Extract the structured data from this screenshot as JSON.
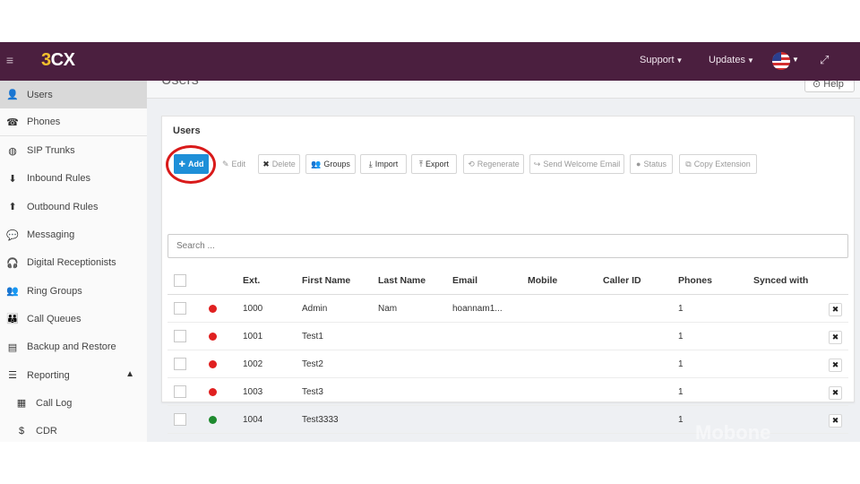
{
  "topbar": {
    "logo_3": "3",
    "logo_cx": "CX",
    "support_label": "Support",
    "updates_label": "Updates"
  },
  "sidebar": {
    "items": [
      {
        "label": "Users",
        "icon": "user-icon",
        "glyph": "👤"
      },
      {
        "label": "Phones",
        "icon": "phone-icon",
        "glyph": "☎"
      },
      {
        "label": "SIP Trunks",
        "icon": "globe-icon",
        "glyph": "◍"
      },
      {
        "label": "Inbound Rules",
        "icon": "arrow-down-icon",
        "glyph": "⬇"
      },
      {
        "label": "Outbound Rules",
        "icon": "arrow-up-icon",
        "glyph": "⬆"
      },
      {
        "label": "Messaging",
        "icon": "chat-icon",
        "glyph": "💬"
      },
      {
        "label": "Digital Receptionists",
        "icon": "headset-icon",
        "glyph": "🎧"
      },
      {
        "label": "Ring Groups",
        "icon": "group-icon",
        "glyph": "👥"
      },
      {
        "label": "Call Queues",
        "icon": "queue-icon",
        "glyph": "👪"
      },
      {
        "label": "Backup and Restore",
        "icon": "database-icon",
        "glyph": "▤"
      },
      {
        "label": "Reporting",
        "icon": "list-icon",
        "glyph": "☰"
      },
      {
        "label": "Call Log",
        "icon": "document-icon",
        "glyph": "▦"
      },
      {
        "label": "CDR",
        "icon": "dollar-icon",
        "glyph": "$"
      }
    ]
  },
  "page": {
    "title_partial": "Users",
    "help_label": "Help"
  },
  "panel": {
    "title": "Users",
    "toolbar": {
      "add": "Add",
      "edit": "Edit",
      "delete": "Delete",
      "groups": "Groups",
      "import": "Import",
      "export": "Export",
      "regenerate": "Regenerate",
      "send_welcome_email": "Send Welcome Email",
      "status": "Status",
      "copy_extension": "Copy Extension"
    },
    "search_placeholder": "Search ..."
  },
  "table": {
    "headers": [
      "Ext.",
      "First Name",
      "Last Name",
      "Email",
      "Mobile",
      "Caller ID",
      "Phones",
      "Synced with"
    ],
    "rows": [
      {
        "ext": "1000",
        "first": "Admin",
        "last": "Nam",
        "email": "hoannam1...",
        "mobile": "",
        "caller_id": "",
        "phones": "1",
        "synced": "",
        "status_color": "#e02020"
      },
      {
        "ext": "1001",
        "first": "Test1",
        "last": "",
        "email": "",
        "mobile": "",
        "caller_id": "",
        "phones": "1",
        "synced": "",
        "status_color": "#e02020"
      },
      {
        "ext": "1002",
        "first": "Test2",
        "last": "",
        "email": "",
        "mobile": "",
        "caller_id": "",
        "phones": "1",
        "synced": "",
        "status_color": "#e02020"
      },
      {
        "ext": "1003",
        "first": "Test3",
        "last": "",
        "email": "",
        "mobile": "",
        "caller_id": "",
        "phones": "1",
        "synced": "",
        "status_color": "#e02020"
      },
      {
        "ext": "1004",
        "first": "Test3333",
        "last": "",
        "email": "",
        "mobile": "",
        "caller_id": "",
        "phones": "1",
        "synced": "",
        "status_color": "#1e8a2e"
      }
    ]
  },
  "watermark": "Mobone",
  "colors": {
    "topbar": "#4b1f3f",
    "accent": "#1e8fd8",
    "highlight": "#d91a1a"
  }
}
